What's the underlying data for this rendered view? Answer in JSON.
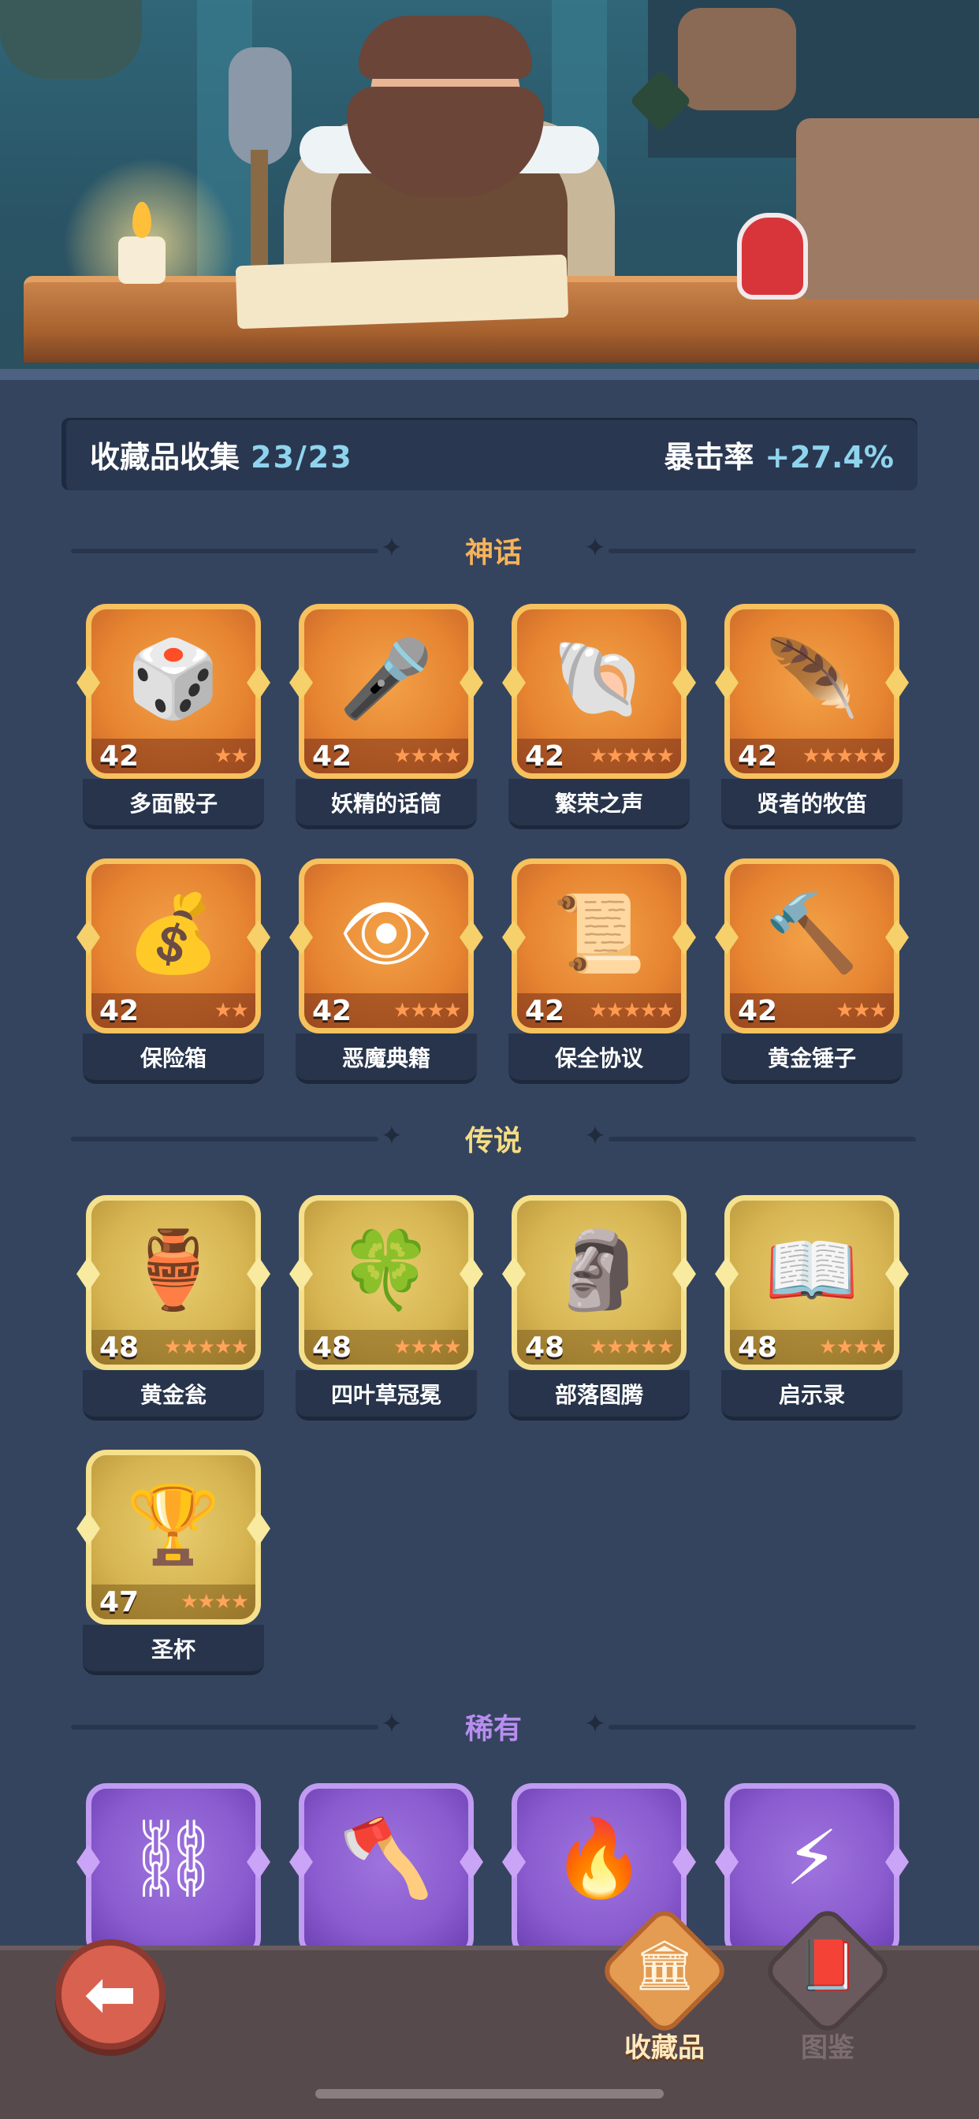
{
  "stats": {
    "title": "收藏品收集",
    "count": "23/23",
    "crit_label": "暴击率",
    "crit_value": "+27.4%"
  },
  "sections": {
    "mythic": {
      "title": "神话"
    },
    "legend": {
      "title": "传说"
    },
    "rare": {
      "title": "稀有"
    }
  },
  "mythic_items": [
    {
      "name": "多面骰子",
      "level": "42",
      "stars": 2,
      "icon": "d20-dice-icon"
    },
    {
      "name": "妖精的话筒",
      "level": "42",
      "stars": 4,
      "icon": "fairy-microphone-icon"
    },
    {
      "name": "繁荣之声",
      "level": "42",
      "stars": 5,
      "icon": "conch-shell-icon"
    },
    {
      "name": "贤者的牧笛",
      "level": "42",
      "stars": 5,
      "icon": "sage-flute-icon"
    },
    {
      "name": "保险箱",
      "level": "42",
      "stars": 2,
      "icon": "treasure-chest-icon"
    },
    {
      "name": "恶魔典籍",
      "level": "42",
      "stars": 4,
      "icon": "demon-book-icon"
    },
    {
      "name": "保全协议",
      "level": "42",
      "stars": 5,
      "icon": "scroll-contract-icon"
    },
    {
      "name": "黄金锤子",
      "level": "42",
      "stars": 3,
      "icon": "golden-hammer-icon"
    }
  ],
  "legend_items": [
    {
      "name": "黄金瓮",
      "level": "48",
      "stars": 5,
      "icon": "golden-vase-icon"
    },
    {
      "name": "四叶草冠冕",
      "level": "48",
      "stars": 4,
      "icon": "clover-crown-icon"
    },
    {
      "name": "部落图腾",
      "level": "48",
      "stars": 5,
      "icon": "tribal-totem-icon"
    },
    {
      "name": "启示录",
      "level": "48",
      "stars": 4,
      "icon": "open-book-icon"
    },
    {
      "name": "圣杯",
      "level": "47",
      "stars": 4,
      "icon": "holy-grail-icon"
    }
  ],
  "rare_items": [
    {
      "icon": "thorn-rings-icon"
    },
    {
      "icon": "stone-axe-icon"
    },
    {
      "icon": "flame-feather-icon"
    },
    {
      "icon": "lightning-card-icon"
    }
  ],
  "nav": {
    "collection_label": "收藏品",
    "codex_label": "图鉴"
  },
  "colors": {
    "background": "#35445e",
    "mythic_accent": "#f5b35a",
    "legend_accent": "#f4dd82",
    "rare_accent": "#b78ef0",
    "stat_value": "#8fd4ee"
  }
}
